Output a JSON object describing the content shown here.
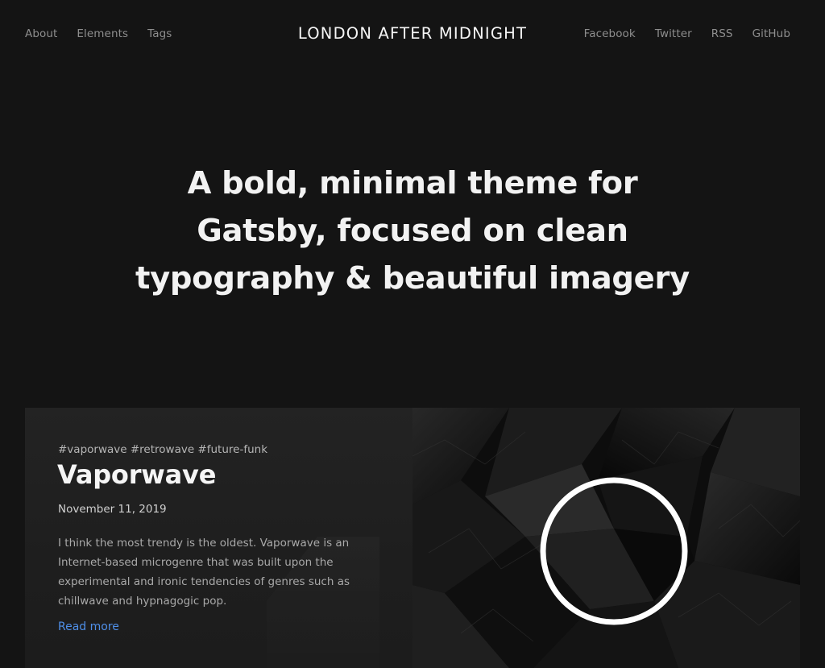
{
  "header": {
    "site_title": "LONDON AFTER MIDNIGHT",
    "nav_left": [
      "About",
      "Elements",
      "Tags"
    ],
    "nav_right": [
      "Facebook",
      "Twitter",
      "RSS",
      "GitHub"
    ]
  },
  "hero": {
    "lines": [
      "A bold, minimal theme for",
      "Gatsby, focused on clean",
      "typography & beautiful imagery"
    ]
  },
  "post": {
    "tags": "#vaporwave #retrowave #future-funk",
    "title": "Vaporwave",
    "date": "November 11, 2019",
    "excerpt": "I think the most trendy is the oldest. Vaporwave is an Internet-based microgenre that was built upon the experimental and ironic tendencies of genres such as chillwave and hypnagogic pop.",
    "read_more": "Read more"
  },
  "colors": {
    "background": "#141414",
    "card_background": "#222222",
    "link_accent": "#4f8fe8",
    "nav_text": "#8e8e8e"
  }
}
